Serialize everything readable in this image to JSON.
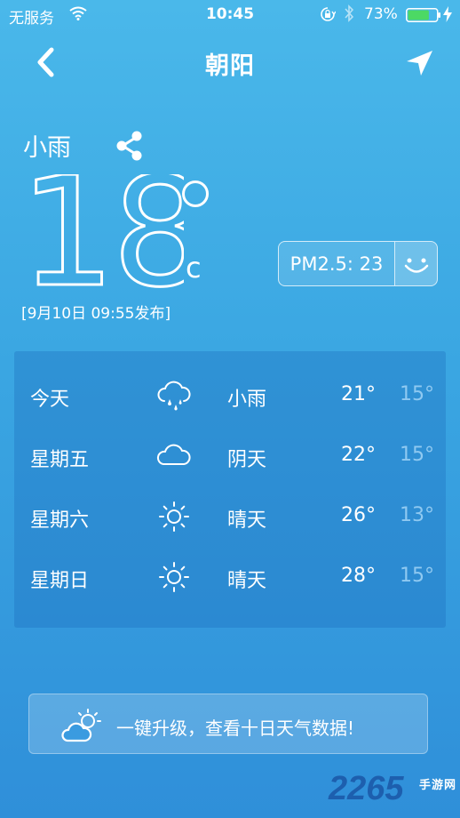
{
  "status_bar": {
    "carrier": "无服务",
    "time": "10:45",
    "battery_percent": "73%",
    "battery_level": 0.73,
    "icons": [
      "wifi-icon",
      "rotation-lock-icon",
      "bluetooth-icon",
      "battery-icon",
      "charging-icon"
    ]
  },
  "nav": {
    "city": "朝阳",
    "icons": [
      "back-arrow-icon",
      "location-arrow-icon"
    ]
  },
  "current": {
    "condition": "小雨",
    "temperature": "18",
    "degree_unit": "C",
    "published": "[9月10日 09:55发布]",
    "pm_label": "PM2.5: 23",
    "pm_icon": "smiley-face-icon",
    "share_icon": "share-icon"
  },
  "forecast": [
    {
      "day": "今天",
      "icon": "rain-cloud-icon",
      "desc": "小雨",
      "hi": "21°",
      "lo": "15°"
    },
    {
      "day": "星期五",
      "icon": "cloud-icon",
      "desc": "阴天",
      "hi": "22°",
      "lo": "15°"
    },
    {
      "day": "星期六",
      "icon": "sun-icon",
      "desc": "晴天",
      "hi": "26°",
      "lo": "13°"
    },
    {
      "day": "星期日",
      "icon": "sun-icon",
      "desc": "晴天",
      "hi": "28°",
      "lo": "15°"
    }
  ],
  "upgrade": {
    "text": "一键升级，查看十日天气数据!",
    "icon": "cloud-sun-icon"
  },
  "watermark": {
    "number": "2265",
    "site": "手游网"
  },
  "colors": {
    "background_top": "#4ab8ea",
    "background_bottom": "#2f8fd9",
    "low_temp": "#8fc9f1",
    "watermark": "#1d5fae"
  }
}
